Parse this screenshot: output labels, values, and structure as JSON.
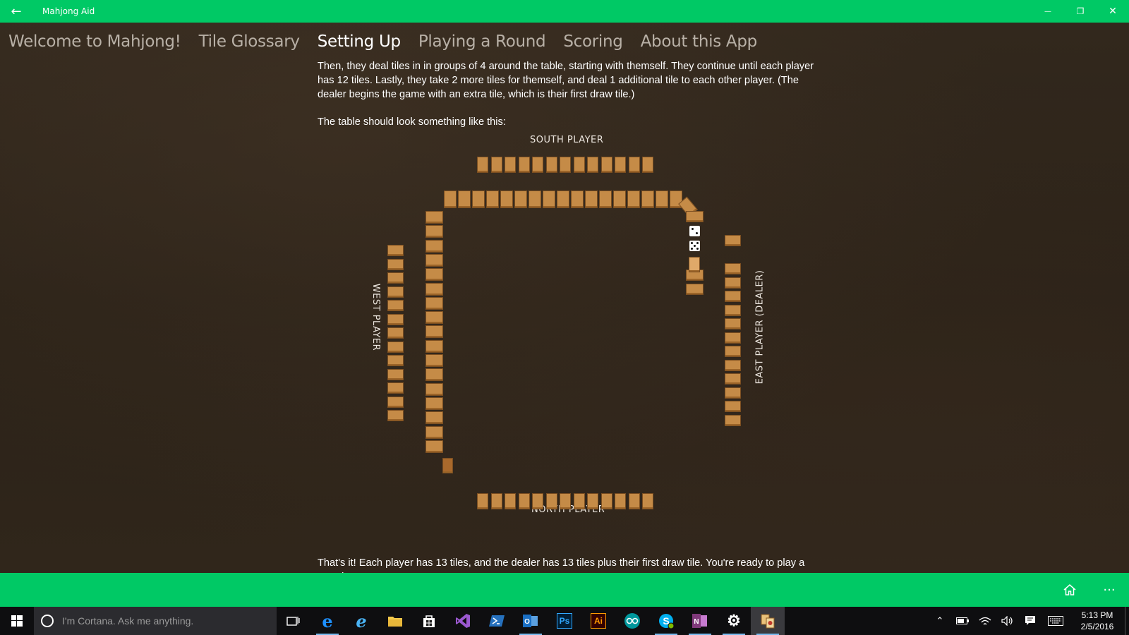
{
  "window": {
    "title": "Mahjong Aid",
    "back_glyph": "←",
    "minimize_glyph": "—",
    "restore_glyph": "❐",
    "close_glyph": "✕"
  },
  "nav": {
    "tabs": [
      {
        "label": "Welcome to Mahjong!",
        "active": false
      },
      {
        "label": "Tile Glossary",
        "active": false
      },
      {
        "label": "Setting Up",
        "active": true
      },
      {
        "label": "Playing a Round",
        "active": false
      },
      {
        "label": "Scoring",
        "active": false
      },
      {
        "label": "About this App",
        "active": false
      }
    ]
  },
  "content": {
    "para1": "Then, they deal tiles in in groups of 4 around the table, starting with themself. They continue until each player has 12 tiles. Lastly, they take 2 more tiles for themself, and deal 1 additional tile to each other player. (The dealer begins the game with an extra tile, which is their first draw tile.)",
    "para2": "The table should look something like this:",
    "closing": "That's it! Each player has 13 tiles, and the dealer has 13 tiles plus their first draw tile. You're ready to play a round."
  },
  "diagram": {
    "south_label": "SOUTH PLAYER",
    "north_label": "NORTH PLAYER",
    "west_label": "WEST PLAYER",
    "east_label": "EAST PLAYER (DEALER)",
    "south_hand_tiles": 13,
    "north_hand_tiles": 13,
    "west_hand_tiles": 13,
    "east_hand_tiles": 13
  },
  "appbar": {
    "home_icon": "home-icon",
    "more_glyph": "···"
  },
  "taskbar": {
    "cortana_placeholder": "I'm Cortana. Ask me anything.",
    "time": "5:13 PM",
    "date": "2/5/2016",
    "pinned": [
      "task-view",
      "edge",
      "internet-explorer",
      "file-explorer",
      "store",
      "visual-studio",
      "powershell",
      "outlook",
      "photoshop",
      "illustrator",
      "arduino",
      "skype",
      "onenote",
      "settings",
      "mahjong-aid"
    ]
  },
  "colors": {
    "accent": "#00c965",
    "tile": "#c58b47",
    "background": "#2e2419"
  }
}
